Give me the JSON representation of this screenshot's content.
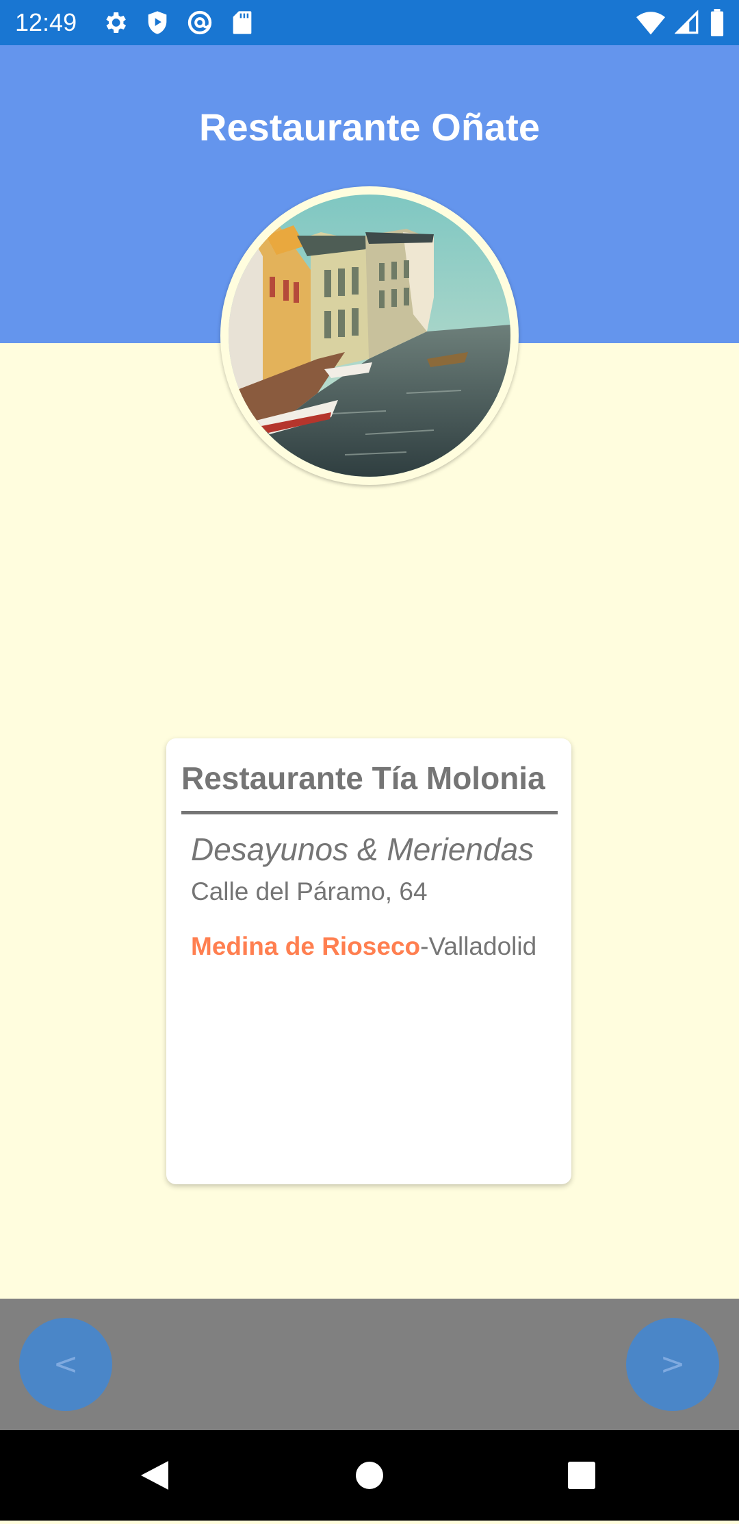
{
  "status_bar": {
    "time": "12:49",
    "left_icons": [
      "gear-icon",
      "shield-play-icon",
      "at-sign-icon",
      "sd-card-icon"
    ],
    "right_icons": [
      "wifi-icon",
      "cellular-signal-icon",
      "battery-icon"
    ]
  },
  "header": {
    "title": "Restaurante Oñate",
    "background": "#6495ED"
  },
  "card": {
    "title": "Restaurante Tía Molonia",
    "subtitle": "Desayunos & Meriendas",
    "address": "Calle del Páramo, 64",
    "city": "Medina de Rioseco",
    "separator": "-",
    "province": "Valladolid",
    "city_color": "#FF7F50"
  },
  "navigation": {
    "prev_label": "<",
    "next_label": ">"
  },
  "system_nav": [
    "back-icon",
    "home-icon",
    "recents-icon"
  ]
}
